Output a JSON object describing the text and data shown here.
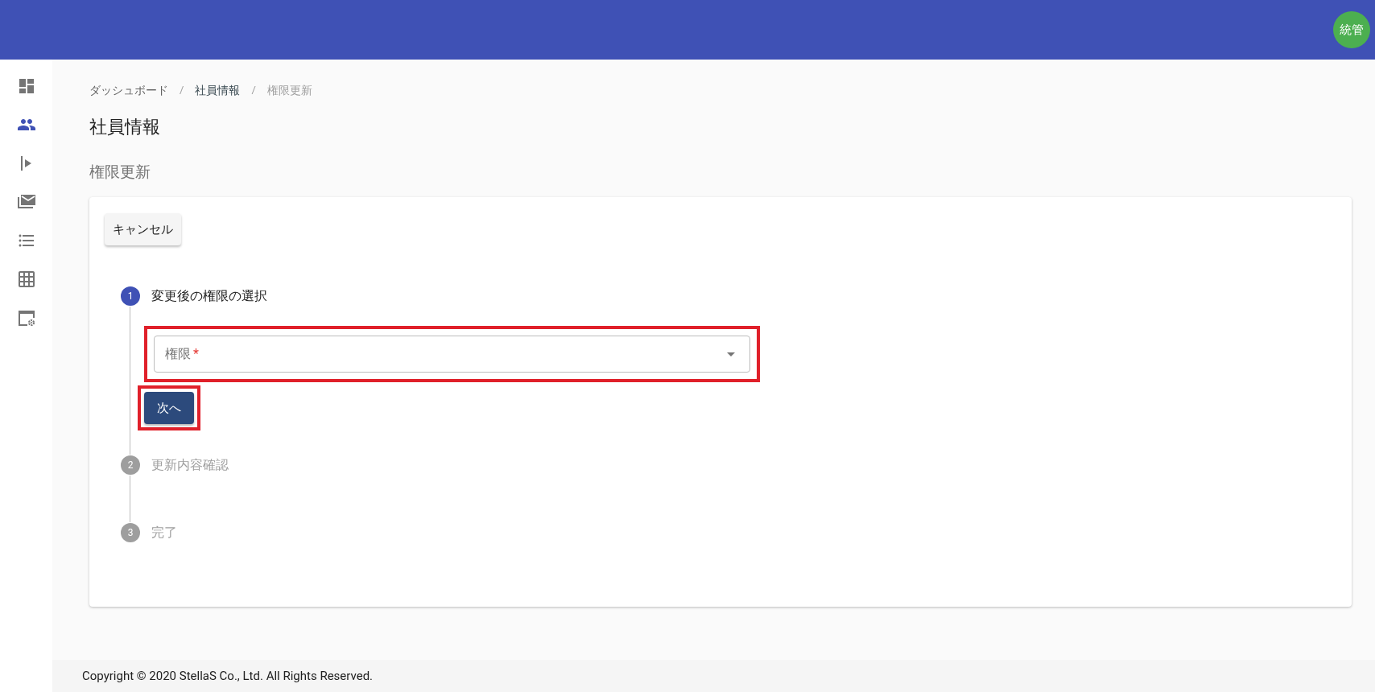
{
  "header": {
    "avatar": "統管"
  },
  "sidebar": {
    "items": [
      {
        "selected": false
      },
      {
        "selected": true
      },
      {
        "selected": false
      },
      {
        "selected": false
      },
      {
        "selected": false
      },
      {
        "selected": false
      },
      {
        "selected": false
      }
    ]
  },
  "breadcrumb": [
    {
      "label": "ダッシュボード",
      "current": false
    },
    {
      "label": "社員情報",
      "current": false
    },
    {
      "label": "権限更新",
      "current": true
    }
  ],
  "separator": "/",
  "title": "社員情報",
  "subtitle": "権限更新",
  "cancel_button": "キャンセル",
  "steps": [
    {
      "number": "1",
      "label": "変更後の権限の選択",
      "active": true
    },
    {
      "number": "2",
      "label": "更新内容確認",
      "active": false
    },
    {
      "number": "3",
      "label": "完了",
      "active": false
    }
  ],
  "select": {
    "label": "権限",
    "required_mark": "*",
    "highlighted": true
  },
  "next_button": {
    "label": "次へ",
    "highlighted": true
  },
  "footer": "Copyright © 2020 StellaS Co., Ltd. All Rights Reserved."
}
